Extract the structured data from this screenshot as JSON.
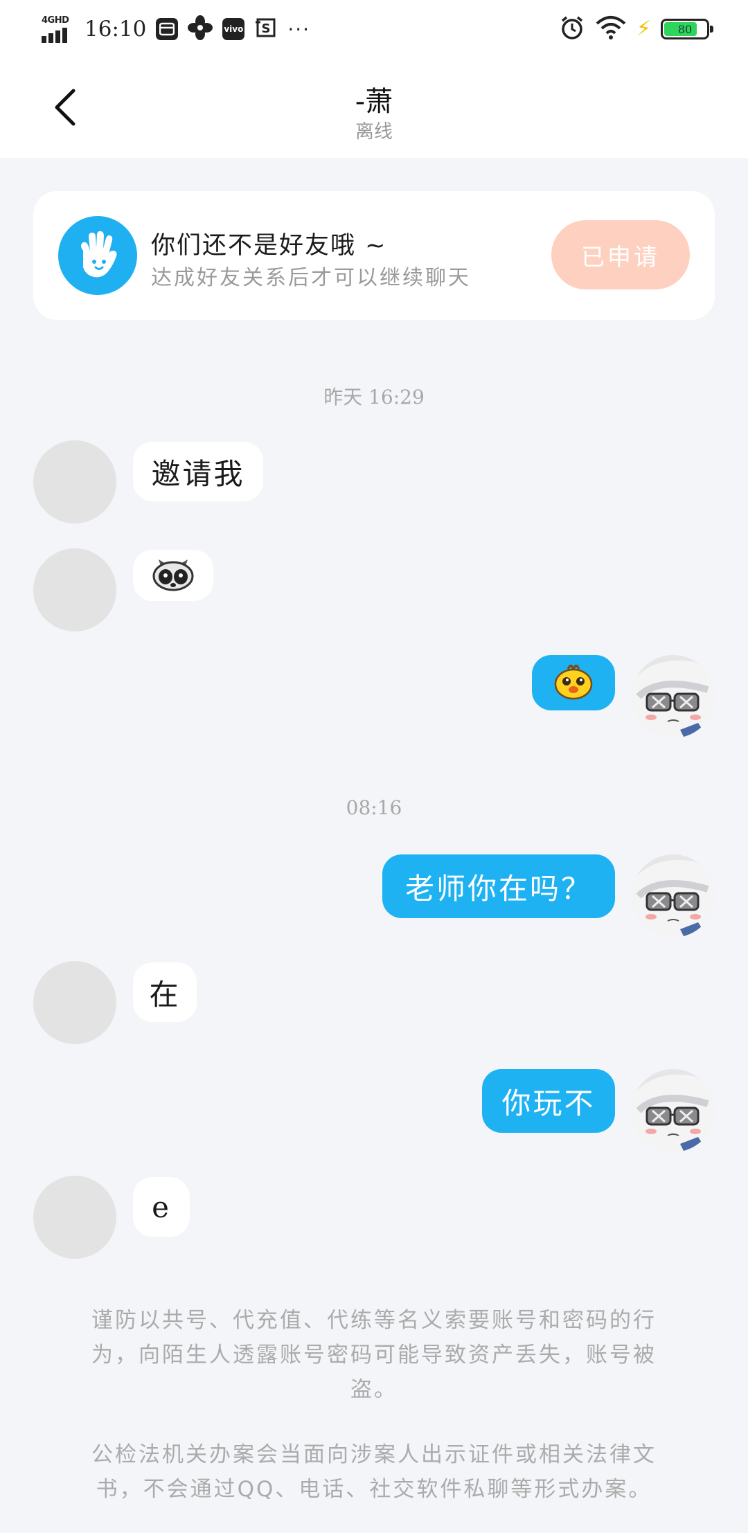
{
  "status_bar": {
    "network": "4GHD",
    "time": "16:10",
    "app_icons": [
      "card-app-icon",
      "fan-app-icon",
      "vivo-app-icon",
      "screenshot-app-icon"
    ],
    "vivo_label": "vivo",
    "more": "···",
    "battery_percent": "80",
    "battery_level": 0.8
  },
  "header": {
    "title": "-萧",
    "subtitle": "离线"
  },
  "friend_notice": {
    "title": "你们还不是好友哦 ~",
    "subtitle": "达成好友关系后才可以继续聊天",
    "button_label": "已申请"
  },
  "messages": {
    "time1": "昨天 16:29",
    "m1": "邀请我",
    "time2": "08:16",
    "m4": "老师你在吗？",
    "m5": "在",
    "m6": "你玩不",
    "m7": "e"
  },
  "warnings": {
    "w1": "谨防以共号、代充值、代练等名义索要账号和密码的行为，向陌生人透露账号密码可能导致资产丢失，账号被盗。",
    "w2": "公检法机关办案会当面向涉案人出示证件或相关法律文书，不会通过QQ、电话、社交软件私聊等形式办案。"
  },
  "colors": {
    "accent": "#1eb2f3",
    "applied_button": "#fdd0c0",
    "background": "#f3f5f8"
  }
}
